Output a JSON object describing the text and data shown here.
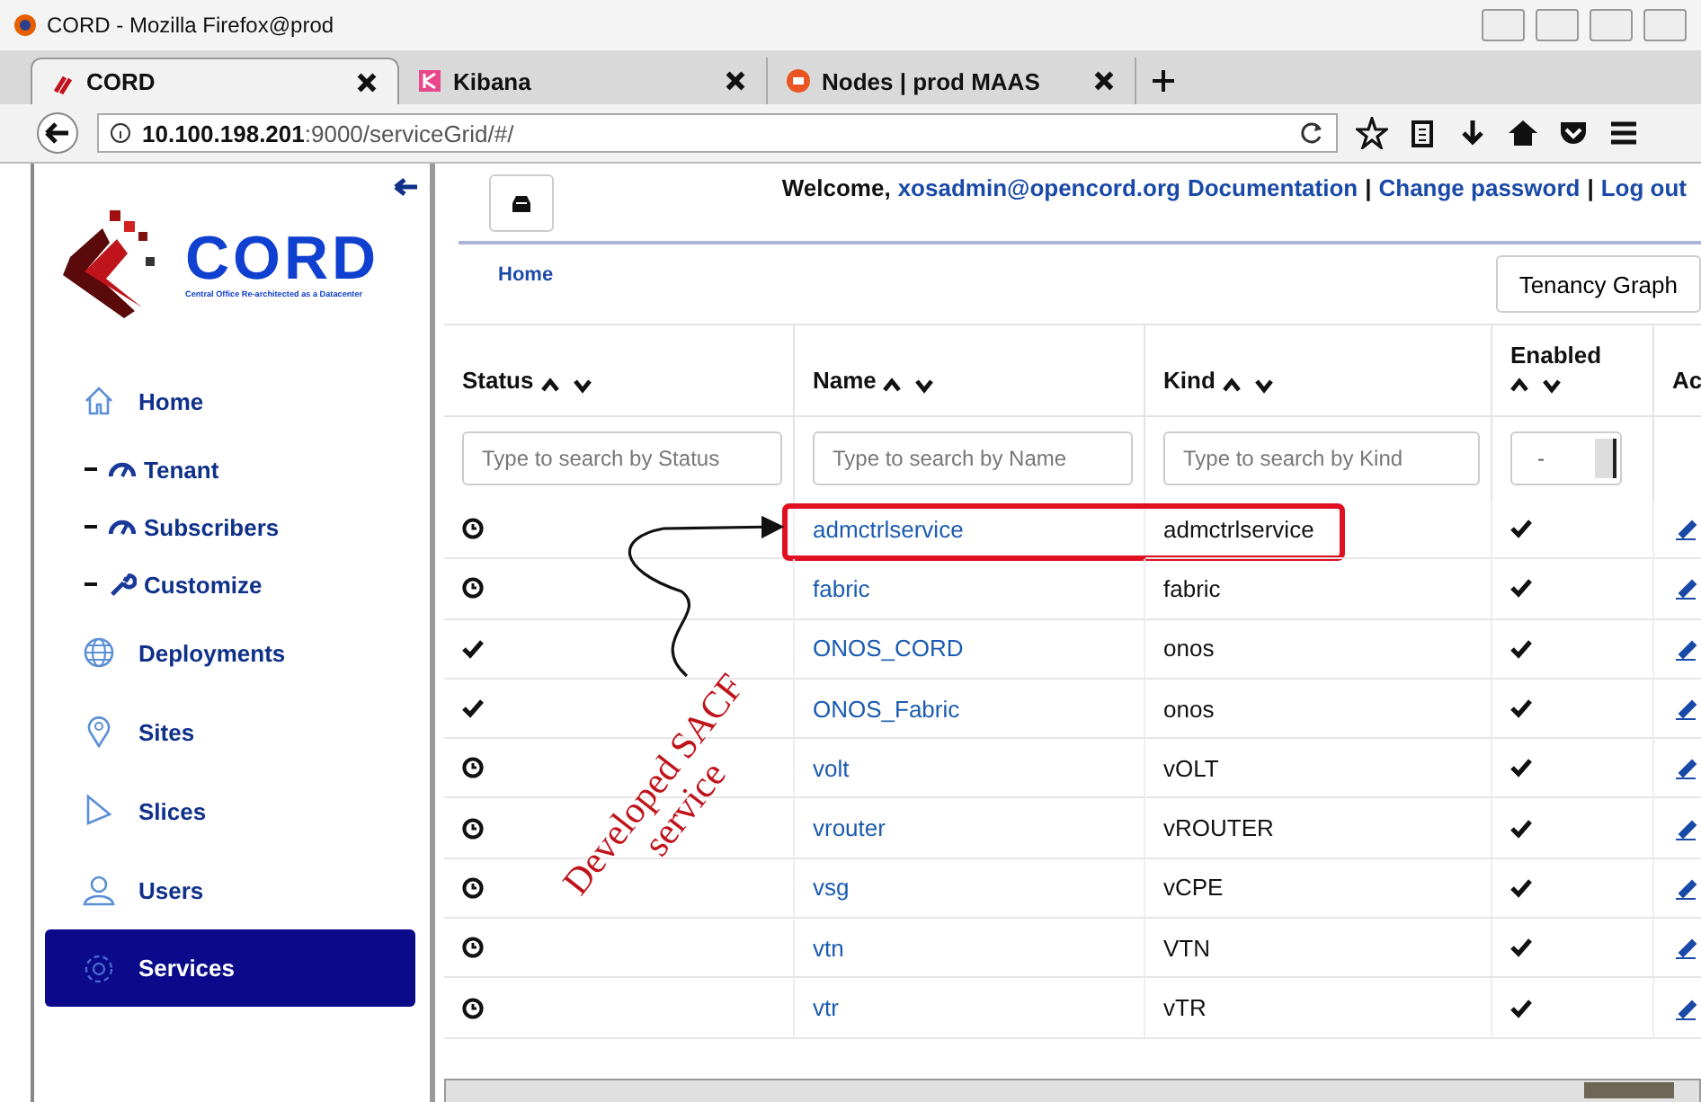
{
  "window": {
    "title": "CORD - Mozilla Firefox@prod"
  },
  "tabs": [
    {
      "label": "CORD",
      "selected": true
    },
    {
      "label": "Kibana",
      "selected": false
    },
    {
      "label": "Nodes | prod MAAS",
      "selected": false
    }
  ],
  "address_bar": {
    "host": "10.100.198.201",
    "path": ":9000/serviceGrid/#/"
  },
  "sidebar": {
    "logo": {
      "wordmark": "CORD",
      "tagline": "Central Office Re-architected as a Datacenter"
    },
    "items": [
      {
        "label": "Home",
        "kind": "main",
        "selected": false
      },
      {
        "label": "Tenant",
        "kind": "sub",
        "selected": false
      },
      {
        "label": "Subscribers",
        "kind": "sub",
        "selected": false
      },
      {
        "label": "Customize",
        "kind": "sub",
        "selected": false
      },
      {
        "label": "Deployments",
        "kind": "main",
        "selected": false
      },
      {
        "label": "Sites",
        "kind": "main",
        "selected": false
      },
      {
        "label": "Slices",
        "kind": "main",
        "selected": false
      },
      {
        "label": "Users",
        "kind": "main",
        "selected": false
      },
      {
        "label": "Services",
        "kind": "main",
        "selected": true
      }
    ]
  },
  "header": {
    "items": [
      {
        "kind": "text",
        "text": "Welcome,"
      },
      {
        "kind": "link",
        "text": "xosadmin@opencord.org"
      },
      {
        "kind": "link",
        "text": "Documentation"
      },
      {
        "kind": "separator",
        "text": "|"
      },
      {
        "kind": "link",
        "text": "Change password"
      },
      {
        "kind": "separator",
        "text": "|"
      },
      {
        "kind": "link",
        "text": "Log out"
      }
    ]
  },
  "breadcrumb": "Home",
  "tenancy_button": "Tenancy Graph",
  "table": {
    "columns": [
      {
        "label": "Status",
        "sortable": true,
        "placeholder": "Type to search by Status"
      },
      {
        "label": "Name",
        "sortable": true,
        "placeholder": "Type to search by Name"
      },
      {
        "label": "Kind",
        "sortable": true,
        "placeholder": "Type to search by Kind"
      },
      {
        "label": "Enabled",
        "sortable": true,
        "select": "-"
      },
      {
        "label": "Ac",
        "sortable": false
      }
    ],
    "rows": [
      {
        "kind": "pending",
        "name": "admctrlservice",
        "service_kind": "admctrlservice",
        "enabled": true,
        "highlighted": true
      },
      {
        "kind": "pending",
        "name": "fabric",
        "service_kind": "fabric",
        "enabled": true,
        "highlighted": false
      },
      {
        "kind": "ok",
        "name": "ONOS_CORD",
        "service_kind": "onos",
        "enabled": true,
        "highlighted": false
      },
      {
        "kind": "ok",
        "name": "ONOS_Fabric",
        "service_kind": "onos",
        "enabled": true,
        "highlighted": false
      },
      {
        "kind": "pending",
        "name": "volt",
        "service_kind": "vOLT",
        "enabled": true,
        "highlighted": false
      },
      {
        "kind": "pending",
        "name": "vrouter",
        "service_kind": "vROUTER",
        "enabled": true,
        "highlighted": false
      },
      {
        "kind": "pending",
        "name": "vsg",
        "service_kind": "vCPE",
        "enabled": true,
        "highlighted": false
      },
      {
        "kind": "pending",
        "name": "vtn",
        "service_kind": "VTN",
        "enabled": true,
        "highlighted": false
      },
      {
        "kind": "pending",
        "name": "vtr",
        "service_kind": "vTR",
        "enabled": true,
        "highlighted": false
      }
    ]
  },
  "annotation": {
    "lines": [
      "Developed SACF",
      "service"
    ]
  }
}
